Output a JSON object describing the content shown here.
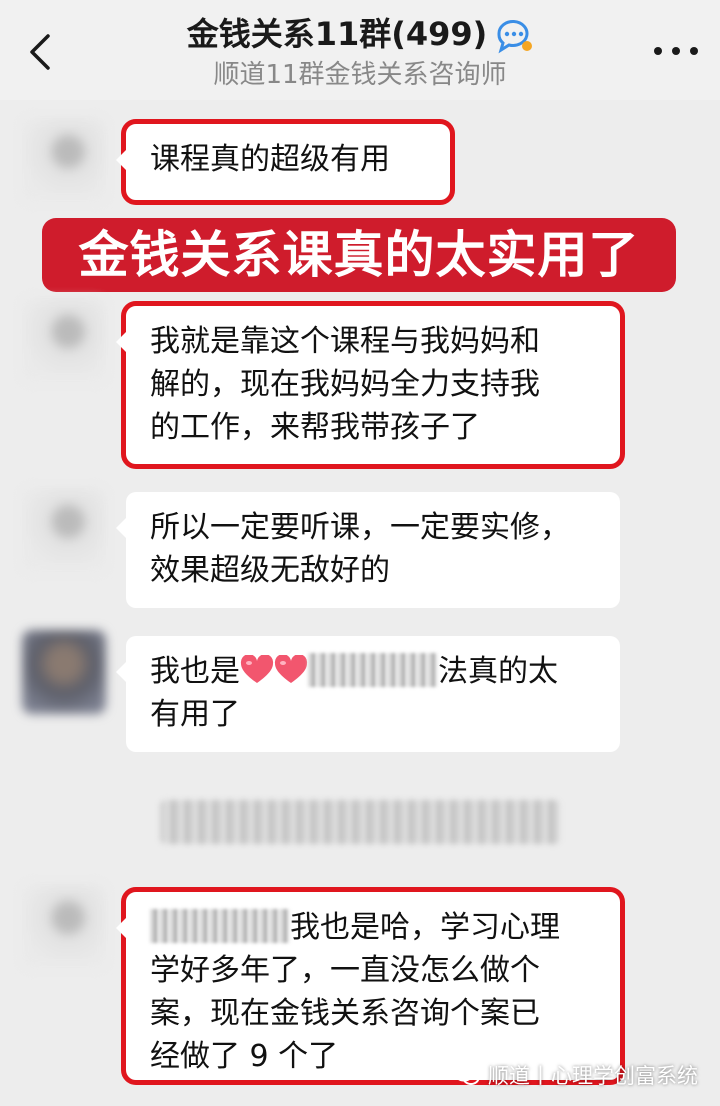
{
  "header": {
    "title": "金钱关系11群(499)",
    "subtitle": "顺道11群金钱关系咨询师"
  },
  "banner": {
    "text": "金钱关系课真的太实用了"
  },
  "messages": [
    {
      "text": "课程真的超级有用"
    },
    {
      "text_lines": [
        "我就是靠这个课程与我妈妈和",
        "解的，现在我妈妈全力支持我",
        "的工作，来帮我带孩子了"
      ]
    },
    {
      "text_lines": [
        "所以一定要听课，一定要实修，",
        "效果超级无敌好的"
      ]
    },
    {
      "prefix": "我也是",
      "suffix": "法真的太",
      "line2": "有用了"
    },
    {
      "line1_suffix": "我也是哈，学习心理",
      "lines": [
        "学好多年了，一直没怎么做个",
        "案，现在金钱关系咨询个案已",
        "经做了 9 个了"
      ]
    }
  ],
  "watermark": {
    "text": "顺道丨心理学创富系统"
  },
  "colors": {
    "highlight": "#e0161e",
    "banner_bg": "#cf1c2c",
    "background": "#ededed",
    "bubble": "#ffffff"
  }
}
